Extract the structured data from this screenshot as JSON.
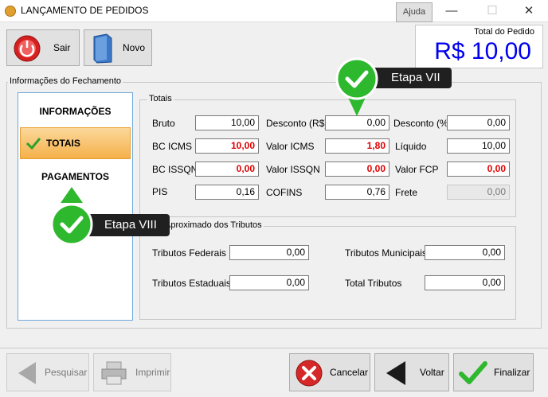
{
  "window": {
    "title": "LANÇAMENTO DE PEDIDOS",
    "help": "Ajuda",
    "minimize": "—",
    "maximize": "☐",
    "close": "✕"
  },
  "toolbar": {
    "exit_label": "Sair",
    "new_label": "Novo"
  },
  "total": {
    "label": "Total do Pedido",
    "value": "R$ 10,00"
  },
  "closing": {
    "group_label": "Informações do Fechamento"
  },
  "nav": {
    "items": [
      "INFORMAÇÕES",
      "TOTAIS",
      "PAGAMENTOS"
    ],
    "selected": "TOTAIS"
  },
  "totals": {
    "group_label": "Totais",
    "bruto": {
      "label": "Bruto",
      "value": "10,00"
    },
    "desconto_rs": {
      "label": "Desconto (R$)",
      "value": "0,00"
    },
    "desconto_pct": {
      "label": "Desconto (%)",
      "value": "0,00"
    },
    "bc_icms": {
      "label": "BC ICMS",
      "value": "10,00"
    },
    "valor_icms": {
      "label": "Valor ICMS",
      "value": "1,80"
    },
    "liquido": {
      "label": "Líquido",
      "value": "10,00"
    },
    "bc_issqn": {
      "label": "BC ISSQN",
      "value": "0,00"
    },
    "valor_issqn": {
      "label": "Valor ISSQN",
      "value": "0,00"
    },
    "valor_fcp": {
      "label": "Valor FCP",
      "value": "0,00"
    },
    "pis": {
      "label": "PIS",
      "value": "0,16"
    },
    "cofins": {
      "label": "COFINS",
      "value": "0,76"
    },
    "frete": {
      "label": "Frete",
      "value": "0,00"
    }
  },
  "taxes": {
    "group_label": "Aproximado dos Tributos",
    "federais": {
      "label": "Tributos Federais",
      "value": "0,00"
    },
    "municipais": {
      "label": "Tributos Municipais",
      "value": "0,00"
    },
    "estaduais": {
      "label": "Tributos Estaduais",
      "value": "0,00"
    },
    "total": {
      "label": "Total Tributos",
      "value": "0,00"
    }
  },
  "callouts": {
    "step7": "Etapa VII",
    "step8": "Etapa VIII"
  },
  "bottom": {
    "search": "Pesquisar",
    "print": "Imprimir",
    "cancel": "Cancelar",
    "back": "Voltar",
    "finish": "Finalizar"
  },
  "colors": {
    "accent_blue": "#0000ee",
    "alert_red": "#e00000",
    "success_green": "#2eb82e",
    "selected_tab": "#f5b04a"
  },
  "icons": [
    "app-icon",
    "power-icon",
    "book-icon",
    "checkmark-icon",
    "arrow-left-icon",
    "printer-icon",
    "cancel-icon",
    "back-arrow-icon",
    "check-confirm-icon"
  ]
}
